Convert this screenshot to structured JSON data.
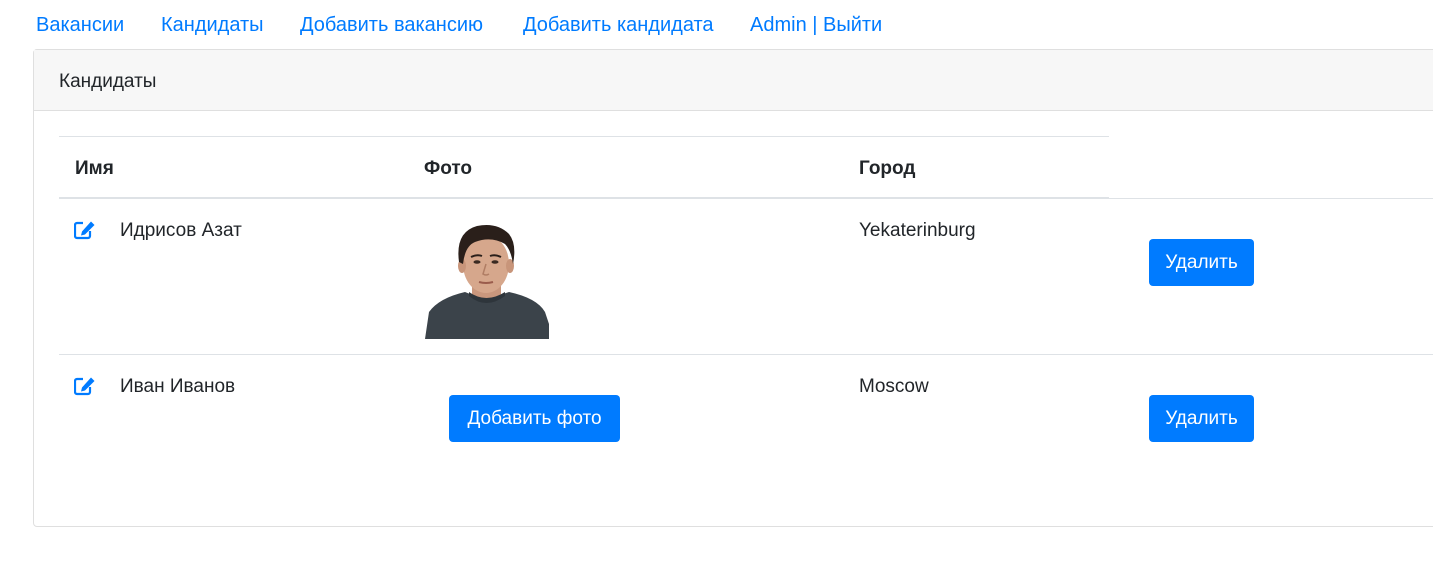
{
  "nav": {
    "vacancies": "Вакансии",
    "candidates": "Кандидаты",
    "add_vacancy": "Добавить вакансию",
    "add_candidate": "Добавить кандидата",
    "user_logout": "Admin | Выйти"
  },
  "card": {
    "header": "Кандидаты"
  },
  "table": {
    "headers": {
      "name": "Имя",
      "photo": "Фото",
      "city": "Город"
    },
    "rows": [
      {
        "name": "Идрисов Азат",
        "city": "Yekaterinburg",
        "delete_label": "Удалить"
      },
      {
        "name": "Иван Иванов",
        "city": "Moscow",
        "add_photo_label": "Добавить фото",
        "delete_label": "Удалить"
      }
    ]
  },
  "colors": {
    "accent": "#007bff",
    "header_bg": "#f7f7f7",
    "text": "#212529"
  },
  "icons": {
    "edit": "edit-icon"
  }
}
